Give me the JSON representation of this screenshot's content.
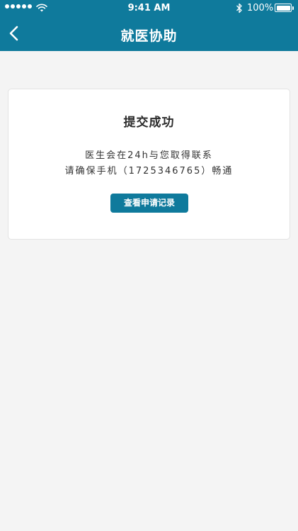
{
  "status_bar": {
    "time": "9:41 AM",
    "battery_percent": "100%",
    "battery_level": 1.0,
    "signal_icon": "signal-dots-icon",
    "wifi_icon": "wifi-icon",
    "bluetooth_icon": "bluetooth-icon"
  },
  "nav": {
    "title": "就医协助",
    "back_icon": "chevron-left-icon"
  },
  "result": {
    "title": "提交成功",
    "line1": "医生会在24h与您取得联系",
    "line2": "请确保手机（1725346765）畅通",
    "button_label": "查看申请记录"
  },
  "colors": {
    "brand": "#0f7a9c",
    "background": "#f4f4f4",
    "card": "#ffffff"
  }
}
